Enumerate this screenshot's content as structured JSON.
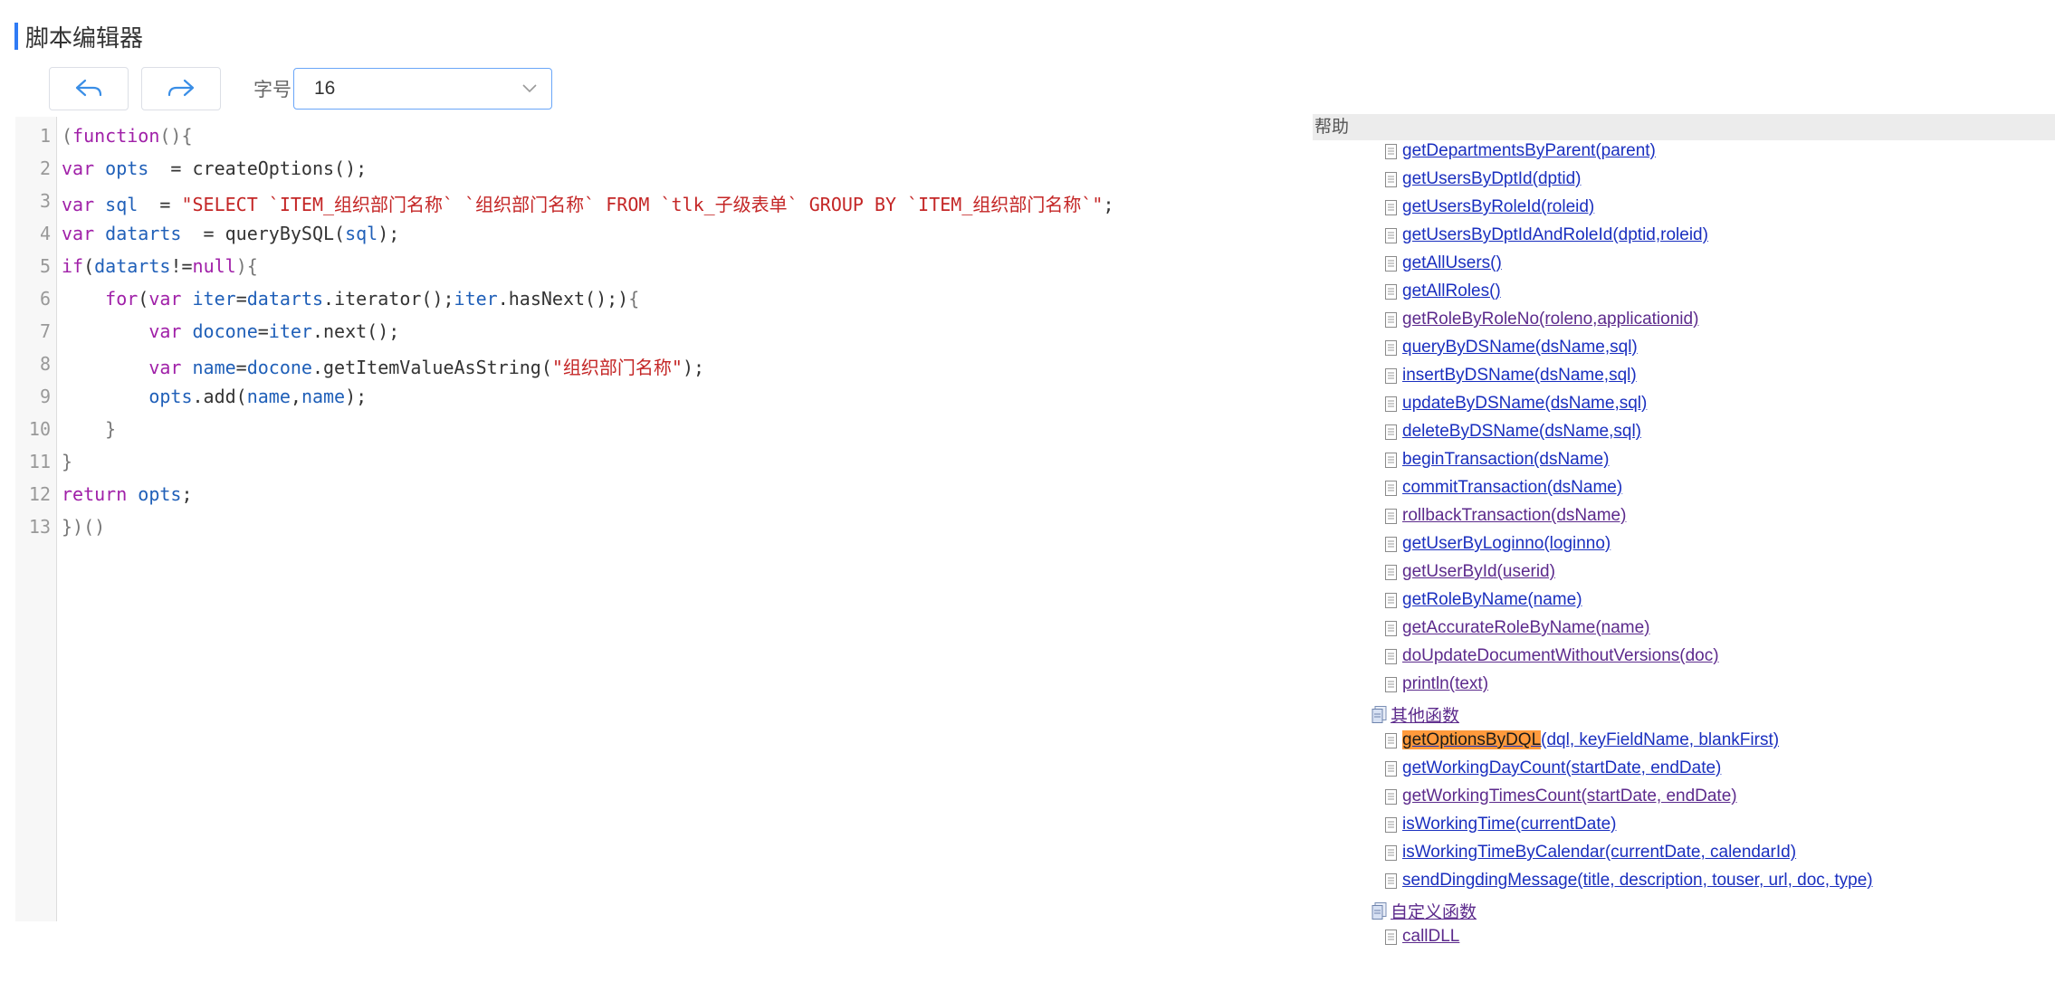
{
  "page": {
    "title": "脚本编辑器"
  },
  "toolbar": {
    "font_size_label": "字号",
    "font_size_value": "16"
  },
  "editor": {
    "line_numbers": [
      "1",
      "2",
      "3",
      "4",
      "5",
      "6",
      "7",
      "8",
      "9",
      "10",
      "11",
      "12",
      "13"
    ]
  },
  "help": {
    "header": "帮助",
    "items": [
      {
        "label": "getDepartmentsByParent(parent)"
      },
      {
        "label": "getUsersByDptId(dptid)"
      },
      {
        "label": "getUsersByRoleId(roleid)"
      },
      {
        "label": "getUsersByDptIdAndRoleId(dptid,roleid)"
      },
      {
        "label": "getAllUsers()"
      },
      {
        "label": "getAllRoles()"
      },
      {
        "label": "getRoleByRoleNo(roleno,applicationid)"
      },
      {
        "label": "queryByDSName(dsName,sql)"
      },
      {
        "label": "insertByDSName(dsName,sql)"
      },
      {
        "label": "updateByDSName(dsName,sql)"
      },
      {
        "label": "deleteByDSName(dsName,sql)"
      },
      {
        "label": "beginTransaction(dsName)"
      },
      {
        "label": "commitTransaction(dsName)"
      },
      {
        "label": "rollbackTransaction(dsName)"
      },
      {
        "label": "getUserByLoginno(loginno)"
      },
      {
        "label": "getUserById(userid)"
      },
      {
        "label": "getRoleByName(name)"
      },
      {
        "label": "getAccurateRoleByName(name)"
      },
      {
        "label": "doUpdateDocumentWithoutVersions(doc)"
      },
      {
        "label": "println(text)"
      }
    ],
    "group_other": "其他函数",
    "other_items": [
      {
        "highlight": "getOptionsByDQL",
        "rest": "(dql, keyFieldName, blankFirst)"
      },
      {
        "label": "getWorkingDayCount(startDate, endDate)"
      },
      {
        "label": "getWorkingTimesCount(startDate, endDate)"
      },
      {
        "label": "isWorkingTime(currentDate)"
      },
      {
        "label": "isWorkingTimeByCalendar(currentDate, calendarId)"
      },
      {
        "label": "sendDingdingMessage(title, description, touser, url, doc, type)"
      }
    ],
    "group_custom": "自定义函数",
    "custom_items": [
      {
        "label": "callDLL"
      }
    ]
  }
}
